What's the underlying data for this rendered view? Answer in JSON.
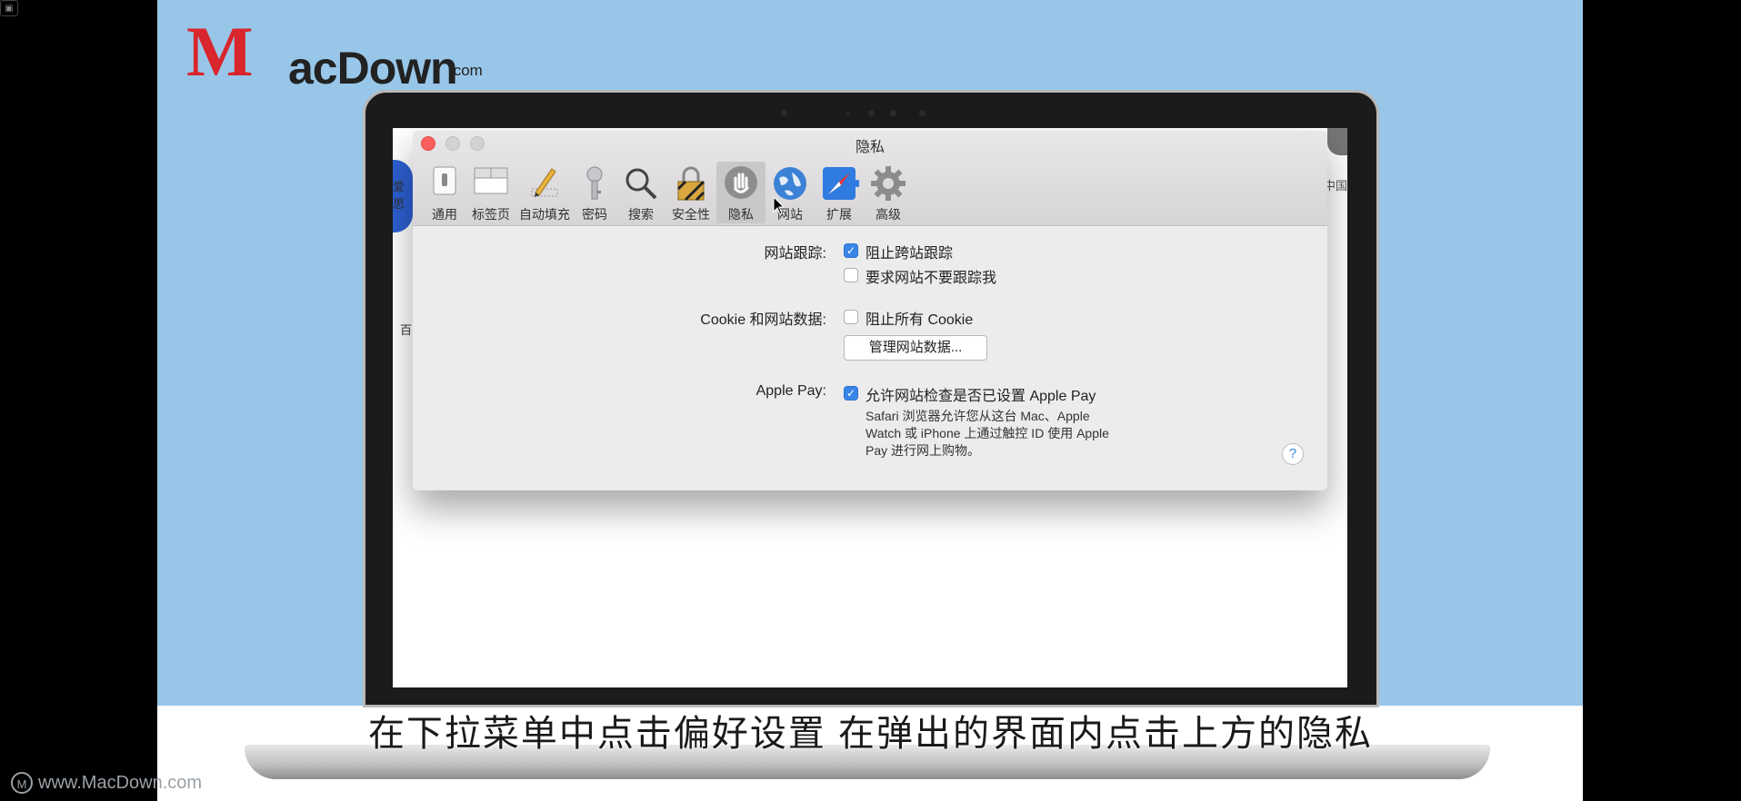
{
  "corner_icon": "▣",
  "logo": {
    "brand_mc": "M",
    "brand_rest": "acDown",
    "brand_dotcom": ".com"
  },
  "screen_bg": {
    "left_fragment_1": "爱思",
    "left_fragment_2": "百",
    "right_fragment": "中国"
  },
  "dialog": {
    "title": "隐私",
    "toolbar": [
      {
        "label": "通用",
        "icon": "general-switch-icon"
      },
      {
        "label": "标签页",
        "icon": "tabs-icon"
      },
      {
        "label": "自动填充",
        "icon": "pencil-icon"
      },
      {
        "label": "密码",
        "icon": "key-icon"
      },
      {
        "label": "搜索",
        "icon": "magnifier-icon"
      },
      {
        "label": "安全性",
        "icon": "lock-icon"
      },
      {
        "label": "隐私",
        "icon": "hand-icon",
        "selected": true
      },
      {
        "label": "网站",
        "icon": "globe-icon"
      },
      {
        "label": "扩展",
        "icon": "puzzle-compass-icon"
      },
      {
        "label": "高级",
        "icon": "gear-icon"
      }
    ],
    "tracking": {
      "label": "网站跟踪:",
      "option1": "阻止跨站跟踪",
      "option1_checked": true,
      "option2": "要求网站不要跟踪我",
      "option2_checked": false
    },
    "cookies": {
      "label": "Cookie 和网站数据:",
      "option": "阻止所有 Cookie",
      "option_checked": false,
      "manage_button": "管理网站数据..."
    },
    "apple_pay": {
      "label": "Apple Pay:",
      "option": "允许网站检查是否已设置 Apple Pay",
      "option_checked": true,
      "desc_line1": "Safari 浏览器允许您从这台 Mac、Apple",
      "desc_line2": "Watch 或 iPhone 上通过触控 ID 使用 Apple",
      "desc_line3": "Pay 进行网上购物。"
    },
    "help": "?"
  },
  "subtitle": "在下拉菜单中点击偏好设置 在弹出的界面内点击上方的隐私",
  "watermark": "www.MacDown.com",
  "watermark_mark": "M"
}
